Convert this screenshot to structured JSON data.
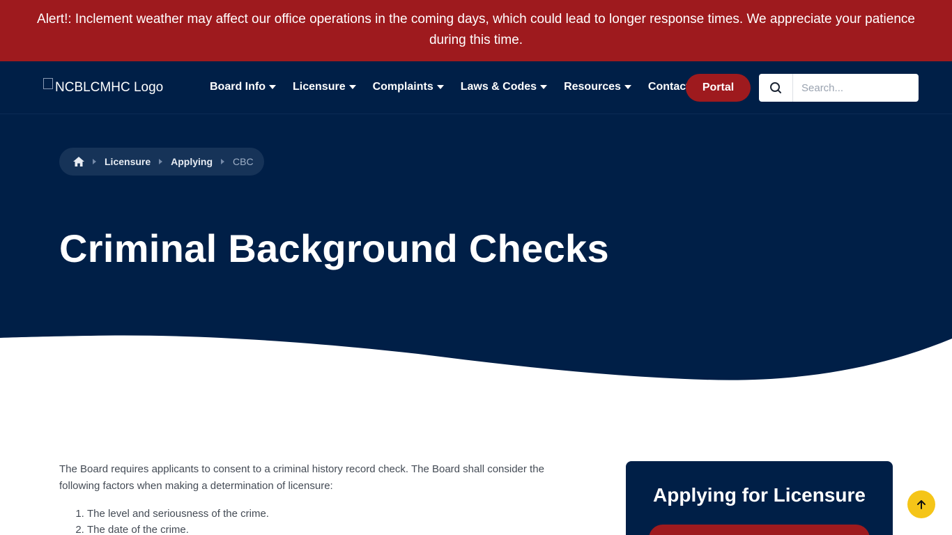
{
  "alert": {
    "text": "Alert!: Inclement weather may affect our office operations in the coming days, which could lead to longer response times. We appreciate your patience during this time."
  },
  "header": {
    "logo_alt": "NCBLCMHC Logo",
    "nav": [
      {
        "label": "Board Info",
        "has_dropdown": true
      },
      {
        "label": "Licensure",
        "has_dropdown": true
      },
      {
        "label": "Complaints",
        "has_dropdown": true
      },
      {
        "label": "Laws & Codes",
        "has_dropdown": true
      },
      {
        "label": "Resources",
        "has_dropdown": true
      },
      {
        "label": "Contact",
        "has_dropdown": false
      }
    ],
    "portal_label": "Portal",
    "search_placeholder": "Search..."
  },
  "hero": {
    "breadcrumb": [
      "Licensure",
      "Applying",
      "CBC"
    ],
    "title": "Criminal Background Checks"
  },
  "main": {
    "intro": "The Board requires applicants to consent to a criminal history record check. The Board shall consider the following factors when making a determination of licensure:",
    "factors": [
      "The level and seriousness of the crime.",
      "The date of the crime."
    ]
  },
  "sidebar": {
    "title": "Applying for Licensure"
  },
  "colors": {
    "alert_bg": "#9e1a1e",
    "navy": "#001f47",
    "accent_red": "#9e1a1e",
    "scroll_button": "#f5c518"
  },
  "icons": {
    "home": "home-icon",
    "search": "search-icon",
    "scroll_top": "arrow-up-icon",
    "dropdown": "caret-down-icon"
  }
}
